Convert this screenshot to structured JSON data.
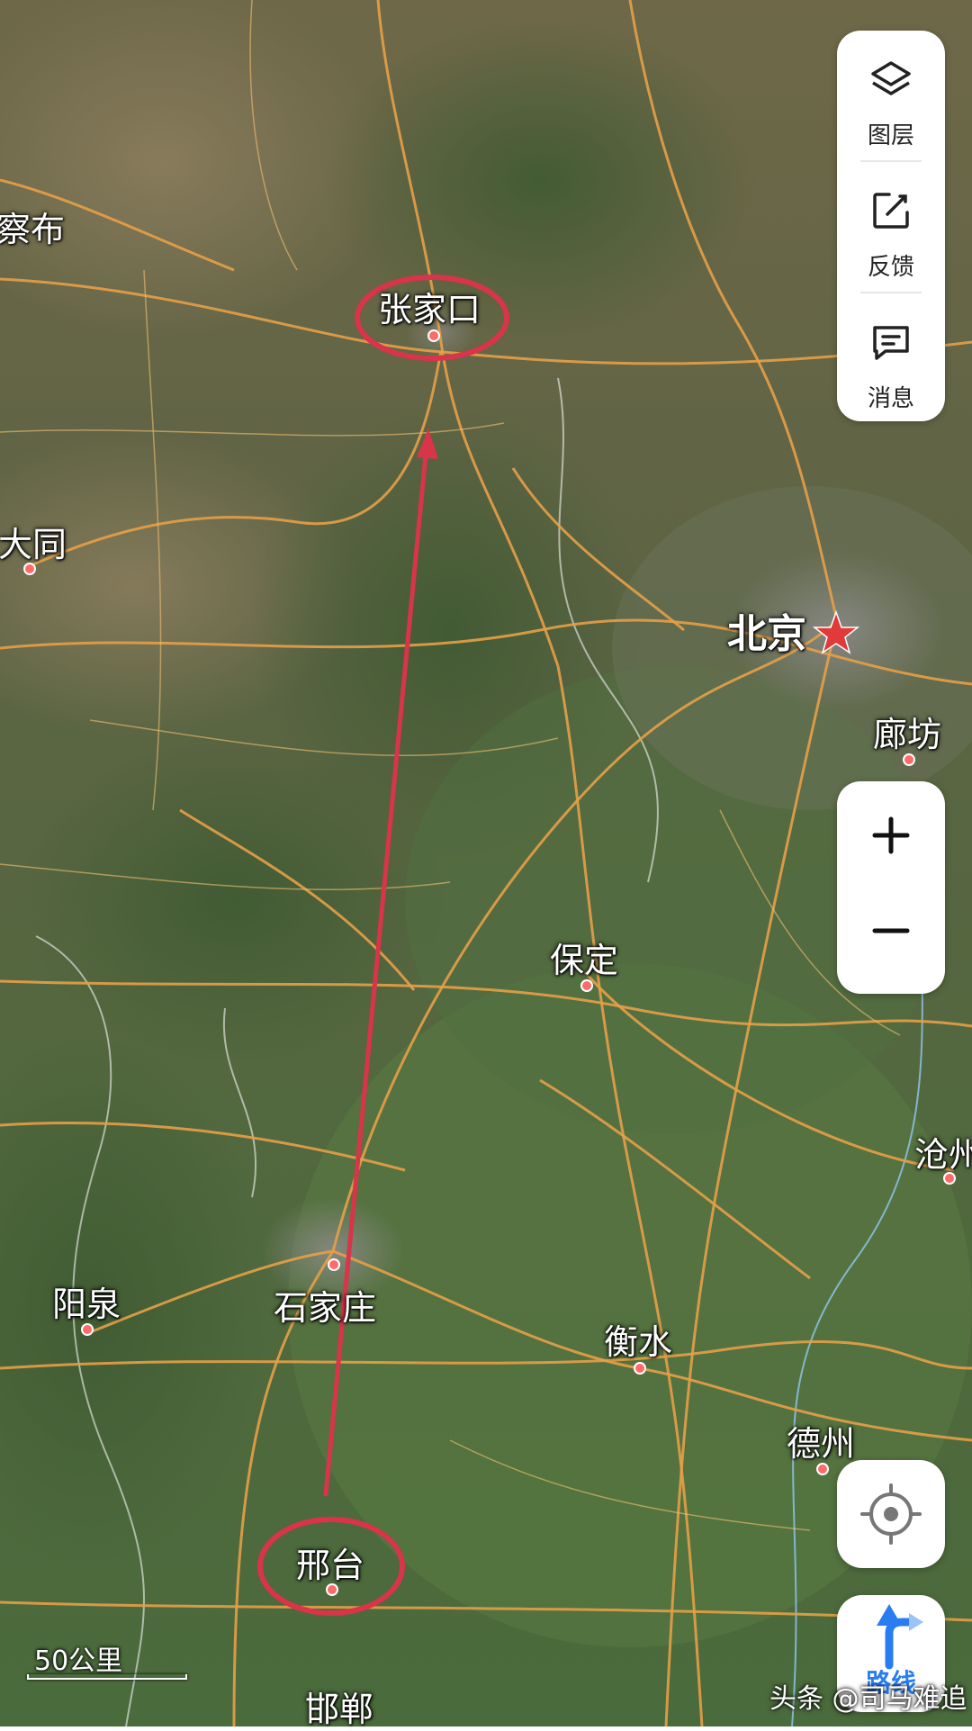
{
  "toolbar": {
    "layers_label": "图层",
    "feedback_label": "反馈",
    "messages_label": "消息"
  },
  "zoom": {
    "in_symbol": "+",
    "out_symbol": "−"
  },
  "cities": {
    "zhangjiakou": "张家口",
    "datong": "大同",
    "beijing": "北京",
    "langfang": "廊坊",
    "baoding": "保定",
    "cangzhou": "沧州",
    "yangquan": "阳泉",
    "shijiazhuang": "石家庄",
    "hengshui": "衡水",
    "dezhou": "德州",
    "xingtai": "邢台",
    "handan": "邯郸",
    "wulanchabu_partial": "察布"
  },
  "scale": {
    "label": "50公里"
  },
  "route_button": {
    "label": "路线"
  },
  "watermark": {
    "text": "头条 @司马难追"
  },
  "colors": {
    "annotation_red": "#d8344a",
    "road_orange": "#e5a048",
    "accent_blue": "#2a7df0",
    "capital_star": "#e03a3a"
  },
  "icons": {
    "layers": "layers-icon",
    "feedback": "edit-icon",
    "messages": "message-icon",
    "locate": "locate-icon",
    "route": "route-arrow-icon"
  }
}
